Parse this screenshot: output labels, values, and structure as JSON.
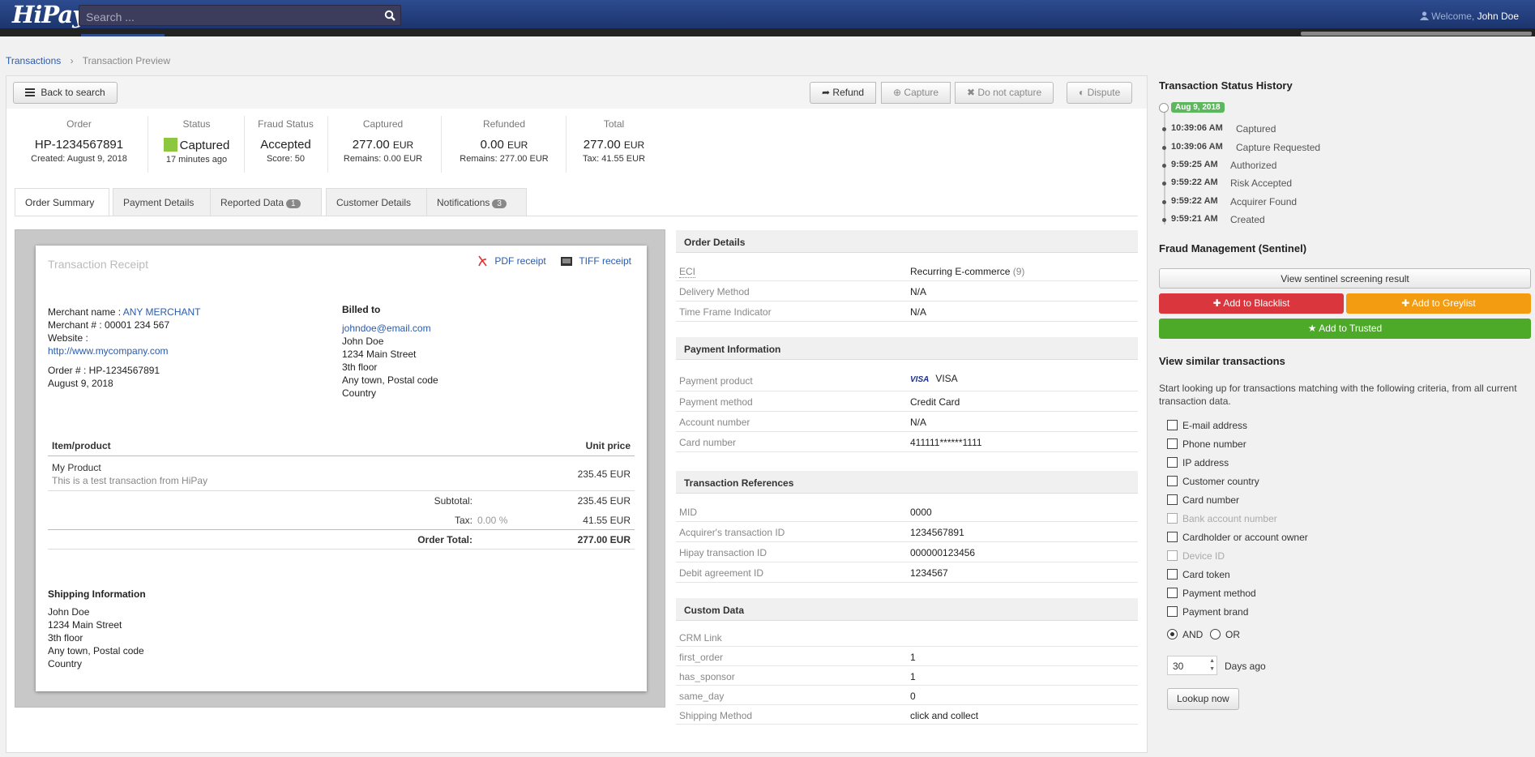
{
  "header": {
    "logo": "HiPay",
    "search_placeholder": "Search ...",
    "welcome": "Welcome,",
    "user": "John Doe"
  },
  "breadcrumb": {
    "root": "Transactions",
    "current": "Transaction Preview"
  },
  "toolbar": {
    "back": "Back to search",
    "refund": "Refund",
    "capture": "Capture",
    "do_not_capture": "Do not capture",
    "dispute": "Dispute"
  },
  "summary": {
    "order": {
      "label": "Order",
      "value": "HP-1234567891",
      "sub": "Created: August 9, 2018"
    },
    "status": {
      "label": "Status",
      "value": "Captured",
      "sub": "17 minutes ago",
      "color": "#8dc63f"
    },
    "fraud": {
      "label": "Fraud Status",
      "value": "Accepted",
      "sub": "Score: 50"
    },
    "captured": {
      "label": "Captured",
      "value": "277.00",
      "cur": "EUR",
      "sub": "Remains: 0.00 EUR"
    },
    "refunded": {
      "label": "Refunded",
      "value": "0.00",
      "cur": "EUR",
      "sub": "Remains: 277.00 EUR"
    },
    "total": {
      "label": "Total",
      "value": "277.00",
      "cur": "EUR",
      "sub": "Tax: 41.55 EUR"
    }
  },
  "tabs": [
    {
      "label": "Order Summary"
    },
    {
      "label": "Payment Details"
    },
    {
      "label": "Reported Data",
      "badge": "1"
    },
    {
      "label": "Customer Details"
    },
    {
      "label": "Notifications",
      "badge": "3"
    }
  ],
  "receipt": {
    "title": "Transaction Receipt",
    "pdf": "PDF receipt",
    "tiff": "TIFF receipt",
    "merchant_name_label": "Merchant name :",
    "merchant_name": "ANY MERCHANT",
    "merchant_no": "Merchant # : 00001 234 567",
    "website_label": "Website :",
    "website": "http://www.mycompany.com",
    "order_no": "Order # : HP-1234567891",
    "order_date": "August 9, 2018",
    "billed_to": "Billed to",
    "email": "johndoe@email.com",
    "billing": [
      "John Doe",
      "1234 Main Street",
      "3th floor",
      "Any town, Postal code",
      "Country"
    ],
    "col_item": "Item/product",
    "col_price": "Unit price",
    "item_name": "My Product",
    "item_desc": "This is a test transaction from HiPay",
    "item_price": "235.45 EUR",
    "subtotal_label": "Subtotal:",
    "subtotal": "235.45 EUR",
    "tax_label": "Tax:",
    "tax_rate": "0.00 %",
    "tax": "41.55 EUR",
    "total_label": "Order Total:",
    "total": "277.00 EUR",
    "shipping_title": "Shipping Information",
    "shipping": [
      "John Doe",
      "1234 Main Street",
      "3th floor",
      "Any town, Postal code",
      "Country"
    ]
  },
  "order_details": {
    "title": "Order Details",
    "rows": [
      {
        "k": "ECI",
        "v": "Recurring E-commerce",
        "extra": "(9)"
      },
      {
        "k": "Delivery Method",
        "v": "N/A"
      },
      {
        "k": "Time Frame Indicator",
        "v": "N/A"
      }
    ]
  },
  "payment_info": {
    "title": "Payment Information",
    "rows": [
      {
        "k": "Payment product",
        "v": "VISA",
        "logo": "VISA"
      },
      {
        "k": "Payment method",
        "v": "Credit Card"
      },
      {
        "k": "Account number",
        "v": "N/A"
      },
      {
        "k": "Card number",
        "v": "411111******1111"
      }
    ]
  },
  "tx_refs": {
    "title": "Transaction References",
    "rows": [
      {
        "k": "MID",
        "v": "0000"
      },
      {
        "k": "Acquirer's transaction ID",
        "v": "1234567891"
      },
      {
        "k": "Hipay transaction ID",
        "v": "000000123456"
      },
      {
        "k": "Debit agreement ID",
        "v": "1234567"
      }
    ]
  },
  "custom_data": {
    "title": "Custom Data",
    "rows": [
      {
        "k": "CRM Link",
        "v": ""
      },
      {
        "k": "first_order",
        "v": "1"
      },
      {
        "k": "has_sponsor",
        "v": "1"
      },
      {
        "k": "same_day",
        "v": "0"
      },
      {
        "k": "Shipping Method",
        "v": "click and collect"
      }
    ]
  },
  "history": {
    "title": "Transaction Status History",
    "date": "Aug 9, 2018",
    "items": [
      {
        "time": "10:39:06 AM",
        "label": "Captured"
      },
      {
        "time": "10:39:06 AM",
        "label": "Capture Requested"
      },
      {
        "time": "9:59:25 AM",
        "label": "Authorized"
      },
      {
        "time": "9:59:22 AM",
        "label": "Risk Accepted"
      },
      {
        "time": "9:59:22 AM",
        "label": "Acquirer Found"
      },
      {
        "time": "9:59:21 AM",
        "label": "Created"
      }
    ]
  },
  "fraud_mgmt": {
    "title": "Fraud Management (Sentinel)",
    "view": "View sentinel screening result",
    "blacklist": "Add to Blacklist",
    "greylist": "Add to Greylist",
    "trusted": "Add to Trusted"
  },
  "similar": {
    "title": "View similar transactions",
    "desc": "Start looking up for transactions matching with the following criteria, from all current transaction data.",
    "criteria": [
      {
        "label": "E-mail address",
        "disabled": false
      },
      {
        "label": "Phone number",
        "disabled": false
      },
      {
        "label": "IP address",
        "disabled": false
      },
      {
        "label": "Customer country",
        "disabled": false
      },
      {
        "label": "Card number",
        "disabled": false
      },
      {
        "label": "Bank account number",
        "disabled": true
      },
      {
        "label": "Cardholder or account owner",
        "disabled": false
      },
      {
        "label": "Device ID",
        "disabled": true
      },
      {
        "label": "Card token",
        "disabled": false
      },
      {
        "label": "Payment method",
        "disabled": false
      },
      {
        "label": "Payment brand",
        "disabled": false
      }
    ],
    "and": "AND",
    "or": "OR",
    "days": "30",
    "days_label": "Days ago",
    "lookup": "Lookup now"
  }
}
